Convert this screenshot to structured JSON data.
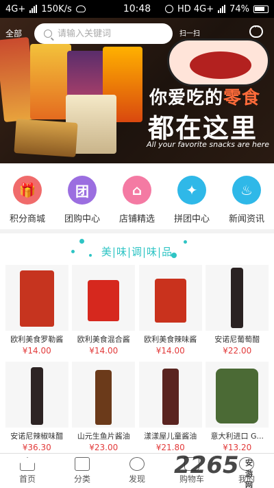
{
  "statusbar": {
    "carrier": "4G+",
    "speed": "150K/s",
    "time": "10:48",
    "network": "HD 4G+",
    "battery": "74%"
  },
  "header": {
    "category_label": "全部",
    "search_placeholder": "请输入关键词",
    "scan_label": "扫一扫"
  },
  "banner": {
    "line1_a": "你爱吃的",
    "line1_b": "零食",
    "line2": "都在这里",
    "subtitle": "All your favorite snacks are here"
  },
  "categories": [
    {
      "label": "积分商城",
      "icon": "gift-icon",
      "color": "#f06b6b"
    },
    {
      "label": "团购中心",
      "icon": "group-buy-icon",
      "color": "#9b6ee0"
    },
    {
      "label": "店铺精选",
      "icon": "store-icon",
      "color": "#f47aa3"
    },
    {
      "label": "拼团中心",
      "icon": "puzzle-icon",
      "color": "#2fb8e8"
    },
    {
      "label": "新闻资讯",
      "icon": "flame-icon",
      "color": "#2fb8e8"
    }
  ],
  "section": {
    "title": "美|味|调|味|品",
    "accent": "#2ec4c4"
  },
  "products": [
    {
      "name": "欧利美食罗勒酱",
      "price": "¥14.00",
      "color": "#c6341f"
    },
    {
      "name": "欧利美食混合酱",
      "price": "¥14.00",
      "color": "#d6281e"
    },
    {
      "name": "欧利美食辣味酱",
      "price": "¥14.00",
      "color": "#c9321d"
    },
    {
      "name": "安诺尼葡萄醋",
      "price": "¥22.00",
      "color": "#2a2222"
    },
    {
      "name": "安诺尼辣椒味醋",
      "price": "¥36.30",
      "color": "#2d2424"
    },
    {
      "name": "山元生鱼片酱油",
      "price": "¥23.00",
      "color": "#6b3a1a"
    },
    {
      "name": "漾漾屋儿童酱油",
      "price": "¥21.80",
      "color": "#5a2420"
    },
    {
      "name": "意大利进口 G...",
      "price": "¥13.20",
      "color": "#4b6a35"
    }
  ],
  "tabbar": [
    {
      "label": "首页",
      "icon": "home-icon"
    },
    {
      "label": "分类",
      "icon": "category-icon"
    },
    {
      "label": "发现",
      "icon": "compass-icon"
    },
    {
      "label": "购物车",
      "icon": "cart-icon"
    },
    {
      "label": "我的",
      "icon": "user-icon"
    }
  ],
  "watermark": {
    "text": "2265",
    "sub": "安游网"
  }
}
